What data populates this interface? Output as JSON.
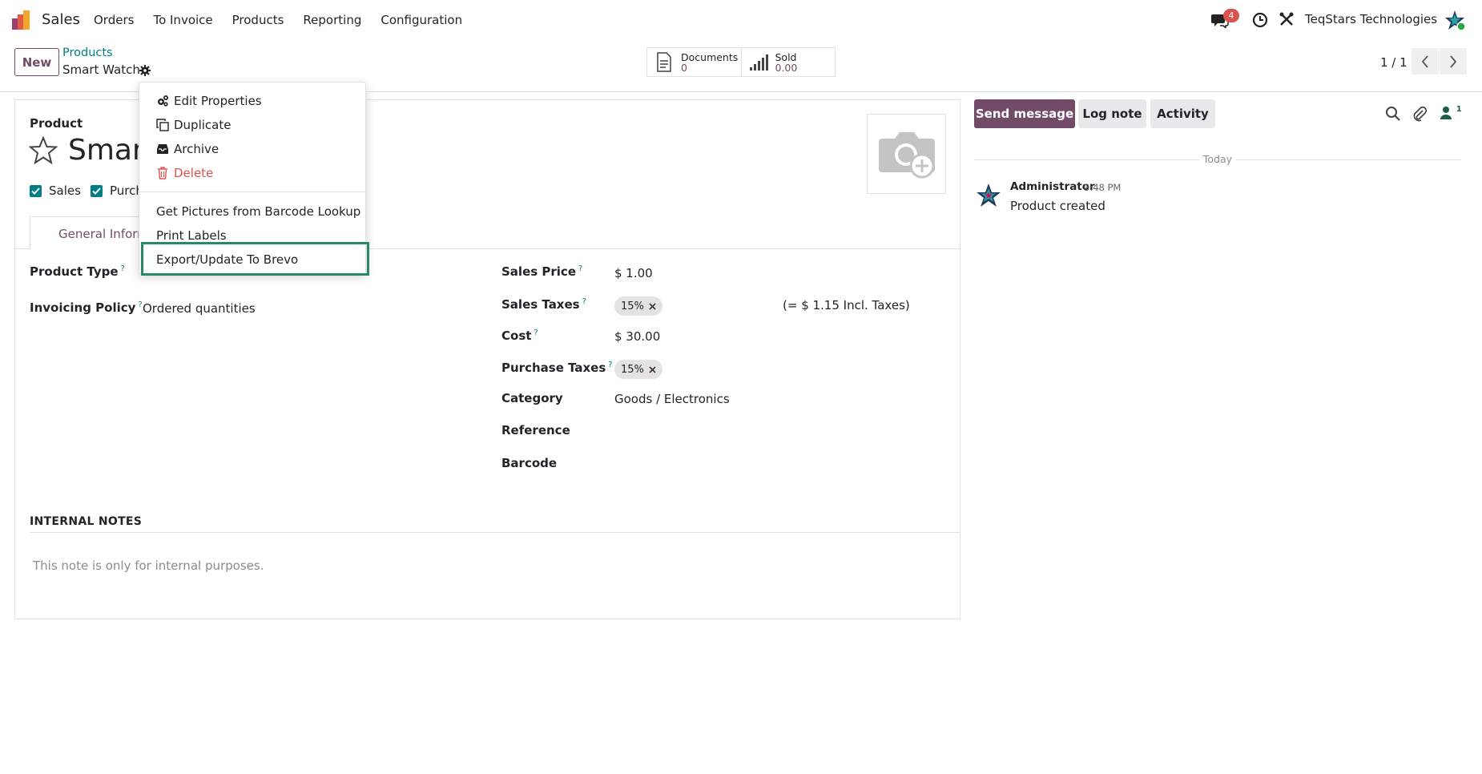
{
  "app": {
    "name": "Sales"
  },
  "menu": [
    "Orders",
    "To Invoice",
    "Products",
    "Reporting",
    "Configuration"
  ],
  "navbar": {
    "chat_count": "4",
    "company": "TeqStars Technologies"
  },
  "control": {
    "new_label": "New",
    "breadcrumb": "Products",
    "record_name": "Smart Watch",
    "smart_buttons": [
      {
        "label": "Documents",
        "value": "0"
      },
      {
        "label": "Sold",
        "value": "0.00"
      }
    ],
    "pager": "1 / 1"
  },
  "form": {
    "product_label": "Product",
    "product_name": "Smart Watch",
    "checkbox_sales": "Sales",
    "checkbox_purchase": "Purch",
    "tab_general": "General Information",
    "product_type_label": "Product Type",
    "invoicing_policy_label": "Invoicing Policy",
    "invoicing_policy_value": "Ordered quantities",
    "sales_price_label": "Sales Price",
    "sales_price_value": "$ 1.00",
    "sales_taxes_label": "Sales Taxes",
    "sales_taxes_tag": "15%",
    "incl_taxes": "(= $ 1.15 Incl. Taxes)",
    "cost_label": "Cost",
    "cost_value": "$ 30.00",
    "purchase_taxes_label": "Purchase Taxes",
    "purchase_taxes_tag": "15%",
    "category_label": "Category",
    "category_value": "Goods / Electronics",
    "reference_label": "Reference",
    "barcode_label": "Barcode",
    "help_mark": "?",
    "internal_notes_title": "INTERNAL NOTES",
    "internal_notes_placeholder": "This note is only for internal purposes."
  },
  "chatter": {
    "send_message": "Send message",
    "log_note": "Log note",
    "activity": "Activity",
    "followers_count": "1",
    "today": "Today",
    "message": {
      "author": "Administrator",
      "time": "3:48 PM",
      "body": "Product created"
    }
  },
  "dropdown": {
    "items": [
      "Edit Properties",
      "Duplicate",
      "Archive",
      "Delete"
    ],
    "actions": [
      "Get Pictures from Barcode Lookup",
      "Print Labels",
      "Export/Update To Brevo"
    ]
  },
  "colors": {
    "primary": "#714b67",
    "link": "#017e84",
    "danger": "#d9534f",
    "highlight": "#2a8a63"
  }
}
